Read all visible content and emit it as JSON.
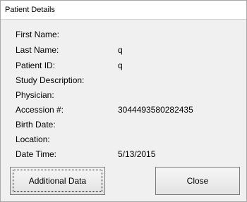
{
  "window": {
    "title": "Patient Details"
  },
  "fields": [
    {
      "label": "First Name:",
      "value": ""
    },
    {
      "label": "Last Name:",
      "value": "q"
    },
    {
      "label": "Patient ID:",
      "value": "q"
    },
    {
      "label": "Study Description:",
      "value": ""
    },
    {
      "label": "Physician:",
      "value": ""
    },
    {
      "label": "Accession #:",
      "value": "3044493580282435"
    },
    {
      "label": "Birth Date:",
      "value": ""
    },
    {
      "label": "Location:",
      "value": ""
    },
    {
      "label": "Date Time:",
      "value": "5/13/2015"
    }
  ],
  "buttons": {
    "additional_data": "Additional Data",
    "close": "Close"
  }
}
